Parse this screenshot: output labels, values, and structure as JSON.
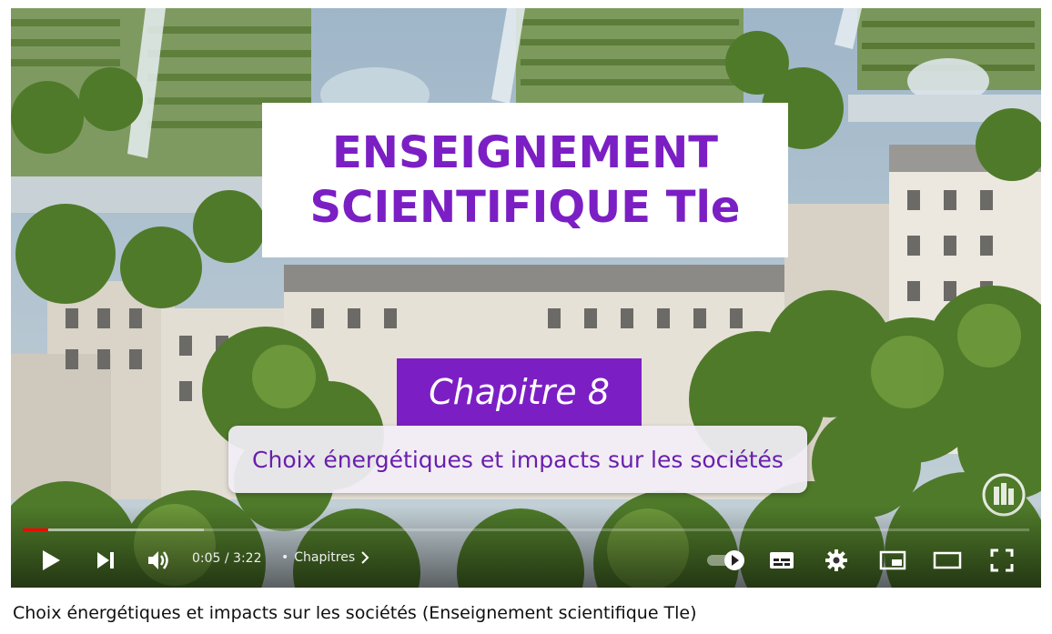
{
  "video": {
    "title_line1": "ENSEIGNEMENT",
    "title_line2": "SCIENTIFIQUE Tle",
    "chapter": "Chapitre 8",
    "subtitle": "Choix énergétiques et impacts sur les sociétés"
  },
  "player": {
    "time": "0:05 / 3:22",
    "chapters_label": "Chapitres",
    "progress_played": 0.025,
    "progress_buffered": 0.18,
    "icons": [
      "play-icon",
      "next-icon",
      "volume-icon",
      "autoplay-toggle-icon",
      "subtitles-icon",
      "settings-icon",
      "miniplayer-icon",
      "theater-mode-icon",
      "fullscreen-icon"
    ]
  },
  "page": {
    "video_title": "Choix énergétiques et impacts sur les sociétés (Enseignement scientifique Tle)"
  },
  "colors": {
    "accent_purple": "#7b1fc4",
    "progress_red": "#ff0000"
  }
}
